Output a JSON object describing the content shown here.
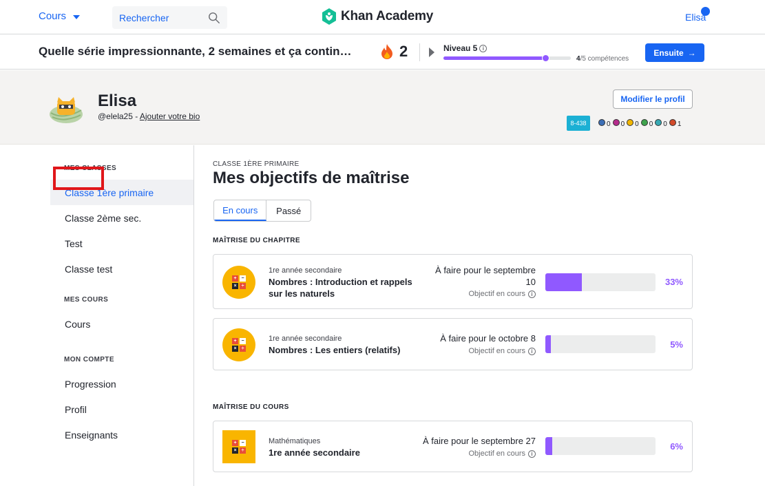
{
  "topnav": {
    "courses_label": "Cours",
    "search_label": "Rechercher",
    "logo_text": "Khan Academy",
    "user_label": "Elisa"
  },
  "streak": {
    "message": "Quelle série impressionnante, 2 semaines et ça contin…",
    "count": "2",
    "level_label": "Niveau 5",
    "level_progress": 0.8,
    "skills_done": "4",
    "skills_total": "/5 compétences",
    "next_label": "Ensuite"
  },
  "profile": {
    "name": "Elisa",
    "handle": "@elela25 - ",
    "bio_link": "Ajouter votre bio",
    "edit_label": "Modifier le profil",
    "points": "8-438",
    "badges": [
      {
        "count": "0",
        "color": "#3d6fb6"
      },
      {
        "count": "0",
        "color": "#b52c8c"
      },
      {
        "count": "0",
        "color": "#f2b600"
      },
      {
        "count": "0",
        "color": "#3fa34d"
      },
      {
        "count": "0",
        "color": "#37a8b3"
      },
      {
        "count": "1",
        "color": "#d24a2a"
      }
    ]
  },
  "sidebar": {
    "classes_heading": "MES CLASSES",
    "classes": [
      "Classe 1ère primaire",
      "Classe 2ème sec.",
      "Test",
      "Classe test"
    ],
    "courses_heading": "MES COURS",
    "courses": [
      "Cours"
    ],
    "account_heading": "MON COMPTE",
    "account": [
      "Progression",
      "Profil",
      "Enseignants"
    ]
  },
  "main": {
    "eyebrow": "CLASSE 1ÈRE PRIMAIRE",
    "title": "Mes objectifs de maîtrise",
    "tabs": [
      "En cours",
      "Passé"
    ],
    "chapter_heading": "MAÎTRISE DU CHAPITRE",
    "course_heading": "MAÎTRISE DU COURS",
    "objective_label": "Objectif en cours",
    "chapter_cards": [
      {
        "subtitle": "1re année secondaire",
        "title": "Nombres : Introduction et rappels sur les naturels",
        "due": "À faire pour le septembre 10",
        "percent": "33%",
        "progress": 33
      },
      {
        "subtitle": "1re année secondaire",
        "title": "Nombres : Les entiers (relatifs)",
        "due": "À faire pour le octobre 8",
        "percent": "5%",
        "progress": 5
      }
    ],
    "course_cards": [
      {
        "subtitle": "Mathématiques",
        "title": "1re année secondaire",
        "due": "À faire pour le septembre 27",
        "percent": "6%",
        "progress": 6
      }
    ]
  }
}
